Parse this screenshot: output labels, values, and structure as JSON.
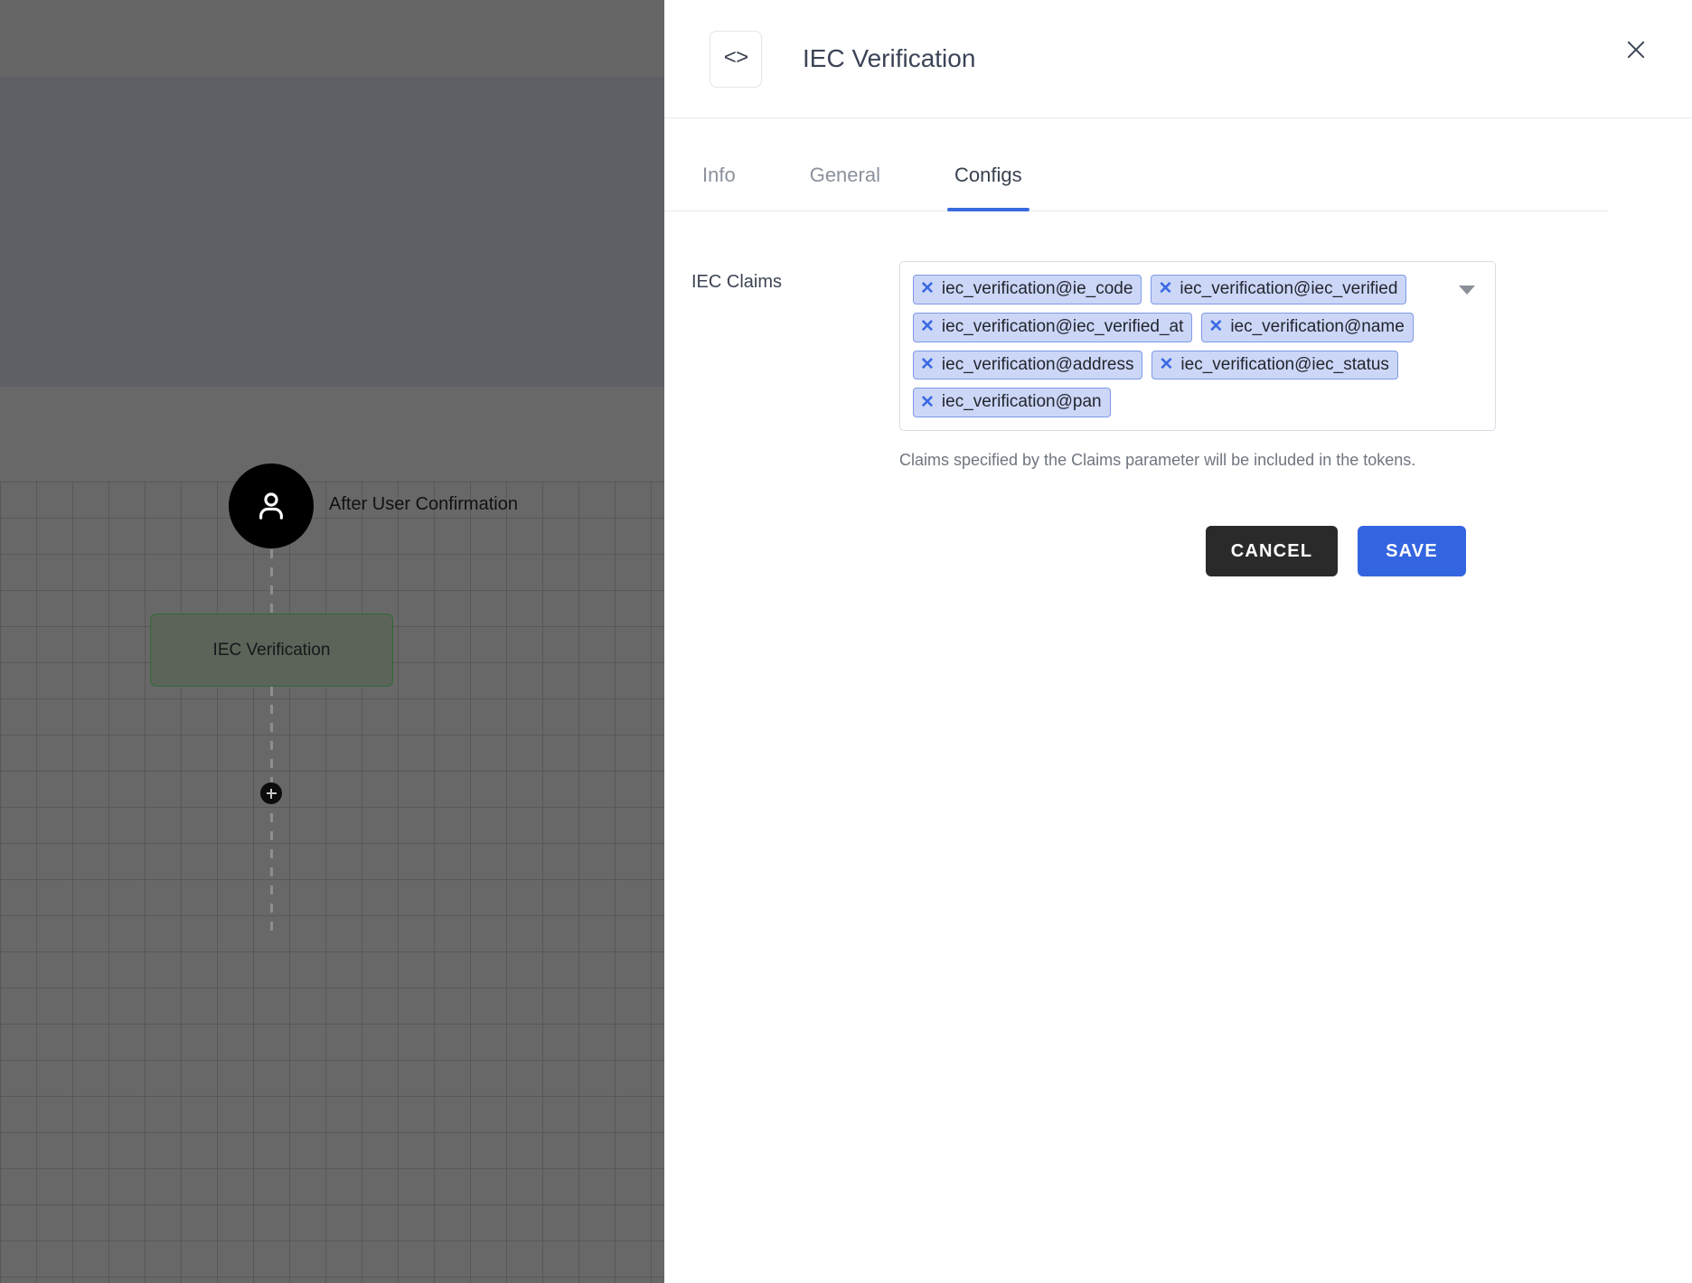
{
  "canvas": {
    "user_node": {
      "icon": "person-icon",
      "label": "After User Confirmation"
    },
    "step_node": {
      "label": "IEC Verification",
      "border_color": "#2f6b36"
    },
    "add_node": {
      "icon": "plus-icon"
    }
  },
  "panel": {
    "header": {
      "icon": "code-brackets-icon",
      "icon_glyph": "<>",
      "title": "IEC Verification",
      "close_icon": "close-icon"
    },
    "tabs": [
      {
        "label": "Info",
        "active": false
      },
      {
        "label": "General",
        "active": false
      },
      {
        "label": "Configs",
        "active": true
      }
    ],
    "active_tab_color": "#3a6ae0",
    "form": {
      "claims_field": {
        "label": "IEC Claims",
        "caret_icon": "chevron-down-icon",
        "chips": [
          {
            "label": "iec_verification@ie_code",
            "remove_icon": "close-icon"
          },
          {
            "label": "iec_verification@iec_verified",
            "remove_icon": "close-icon"
          },
          {
            "label": "iec_verification@iec_verified_at",
            "remove_icon": "close-icon"
          },
          {
            "label": "iec_verification@name",
            "remove_icon": "close-icon"
          },
          {
            "label": "iec_verification@address",
            "remove_icon": "close-icon"
          },
          {
            "label": "iec_verification@iec_status",
            "remove_icon": "close-icon"
          },
          {
            "label": "iec_verification@pan",
            "remove_icon": "close-icon"
          }
        ],
        "helper_text": "Claims specified by the Claims parameter will be included in the tokens."
      }
    },
    "actions": {
      "cancel_label": "CANCEL",
      "save_label": "SAVE",
      "cancel_color": "#2a2a2a",
      "save_color": "#3465e0"
    }
  }
}
